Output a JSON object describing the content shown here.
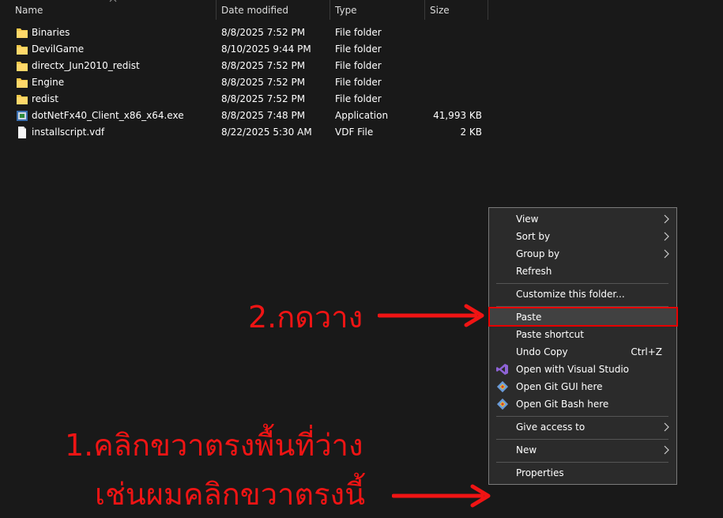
{
  "columns": {
    "name": "Name",
    "date_modified": "Date modified",
    "type": "Type",
    "size": "Size"
  },
  "files": [
    {
      "name": "Binaries",
      "date": "8/8/2025 7:52 PM",
      "type": "File folder",
      "size": "",
      "icon": "folder-icon"
    },
    {
      "name": "DevilGame",
      "date": "8/10/2025 9:44 PM",
      "type": "File folder",
      "size": "",
      "icon": "folder-icon"
    },
    {
      "name": "directx_Jun2010_redist",
      "date": "8/8/2025 7:52 PM",
      "type": "File folder",
      "size": "",
      "icon": "folder-icon"
    },
    {
      "name": "Engine",
      "date": "8/8/2025 7:52 PM",
      "type": "File folder",
      "size": "",
      "icon": "folder-icon"
    },
    {
      "name": "redist",
      "date": "8/8/2025 7:52 PM",
      "type": "File folder",
      "size": "",
      "icon": "folder-icon"
    },
    {
      "name": "dotNetFx40_Client_x86_x64.exe",
      "date": "8/8/2025 7:48 PM",
      "type": "Application",
      "size": "41,993 KB",
      "icon": "installer-icon"
    },
    {
      "name": "installscript.vdf",
      "date": "8/22/2025 5:30 AM",
      "type": "VDF File",
      "size": "2 KB",
      "icon": "document-icon"
    }
  ],
  "context_menu": {
    "view": "View",
    "sort_by": "Sort by",
    "group_by": "Group by",
    "refresh": "Refresh",
    "customize": "Customize this folder...",
    "paste": "Paste",
    "paste_shortcut": "Paste shortcut",
    "undo_copy": "Undo Copy",
    "undo_copy_shortcut": "Ctrl+Z",
    "open_vs": "Open with Visual Studio",
    "open_git_gui": "Open Git GUI here",
    "open_git_bash": "Open Git Bash here",
    "give_access": "Give access to",
    "new": "New",
    "properties": "Properties"
  },
  "annotations": {
    "step2": "2.กดวาง",
    "step1_line1": "1.คลิกขวาตรงพื้นที่ว่าง",
    "step1_line2": "เช่นผมคลิกขวาตรงนี้"
  },
  "colors": {
    "background": "#191919",
    "menu_bg": "#2b2b2b",
    "annotation_red": "#f01414",
    "folder_yellow": "#f4c84a"
  }
}
